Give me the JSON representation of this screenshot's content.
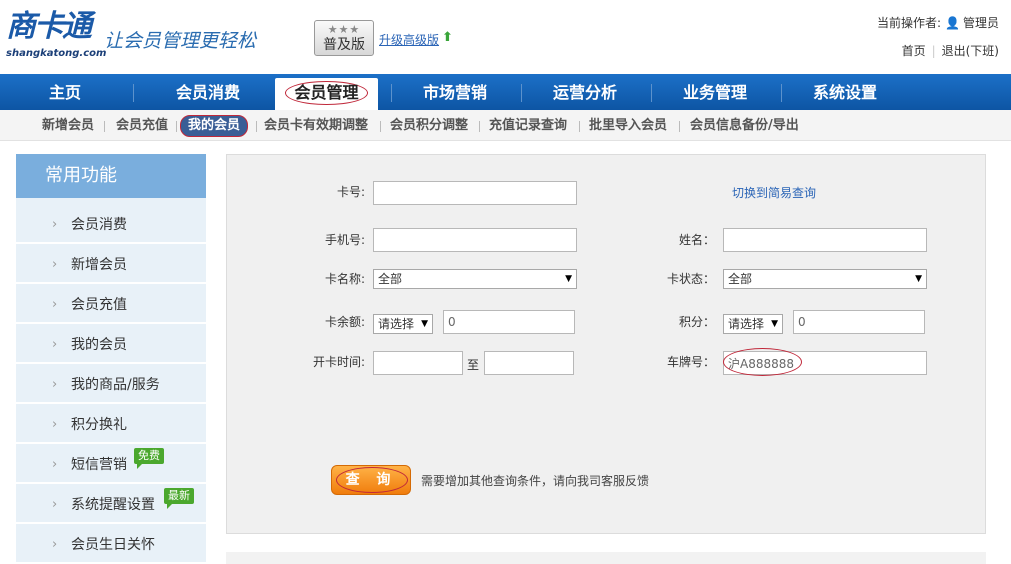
{
  "header": {
    "logo_text": "商卡通",
    "logo_url": "shangkatong.com",
    "slogan": "让会员管理更轻松",
    "edition_stars": "★★★",
    "edition_label": "普及版",
    "upgrade_link": "升级高级版",
    "operator_label": "当前操作者:",
    "operator_name": "管理员",
    "home_link": "首页",
    "logout_link": "退出(下班)"
  },
  "main_nav": {
    "items": [
      "主页",
      "会员消费",
      "会员管理",
      "市场营销",
      "运营分析",
      "业务管理",
      "系统设置"
    ],
    "active_index": 2
  },
  "sub_nav": {
    "items": [
      "新增会员",
      "会员充值",
      "我的会员",
      "会员卡有效期调整",
      "会员积分调整",
      "充值记录查询",
      "批里导入会员",
      "会员信息备份/导出"
    ],
    "active_index": 2
  },
  "sidebar": {
    "title": "常用功能",
    "items": [
      {
        "label": "会员消费"
      },
      {
        "label": "新增会员"
      },
      {
        "label": "会员充值"
      },
      {
        "label": "我的会员"
      },
      {
        "label": "我的商品/服务"
      },
      {
        "label": "积分换礼"
      },
      {
        "label": "短信营销",
        "badge": "免费"
      },
      {
        "label": "系统提醒设置",
        "badge": "最新"
      },
      {
        "label": "会员生日关怀"
      }
    ],
    "badge_color": "#4ba82e"
  },
  "form": {
    "switch_link": "切换到简易查询",
    "card_no": {
      "label": "卡号:",
      "value": ""
    },
    "phone": {
      "label": "手机号:",
      "value": ""
    },
    "name": {
      "label": "姓名：",
      "value": ""
    },
    "card_name": {
      "label": "卡名称:",
      "selected": "全部"
    },
    "card_status": {
      "label": "卡状态：",
      "selected": "全部"
    },
    "balance": {
      "label": "卡余额:",
      "selected": "请选择",
      "value": "0"
    },
    "points": {
      "label": "积分：",
      "selected": "请选择",
      "value": "0"
    },
    "open_time": {
      "label": "开卡时间:",
      "to": "至",
      "from_value": "",
      "to_value": ""
    },
    "plate": {
      "label": "车牌号：",
      "value": "沪A888888"
    },
    "query_button": "查 询",
    "query_hint": "需要增加其他查询条件，请向我司客服反馈"
  },
  "colors": {
    "nav_blue": "#0d55a4",
    "sidebar_title": "#7aaedd",
    "query_orange": "#f07c0c",
    "highlight_circle": "#c0283a"
  }
}
